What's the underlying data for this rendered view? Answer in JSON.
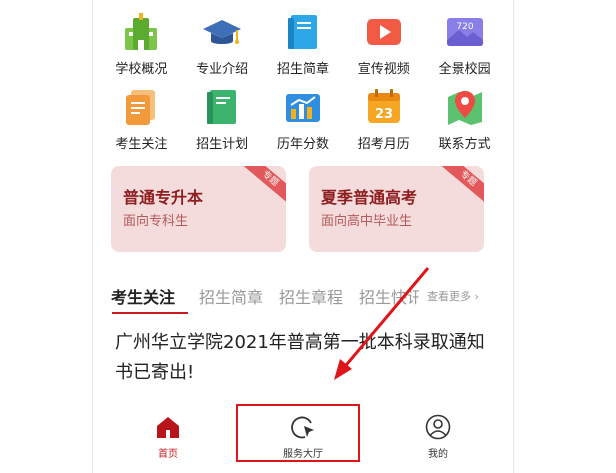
{
  "grid": {
    "row1": [
      {
        "label": "学校概况",
        "icon": "school-building-icon"
      },
      {
        "label": "专业介绍",
        "icon": "graduation-cap-icon"
      },
      {
        "label": "招生简章",
        "icon": "book-icon"
      },
      {
        "label": "宣传视频",
        "icon": "video-play-icon"
      },
      {
        "label": "全景校园",
        "icon": "panorama-720-icon"
      }
    ],
    "row2": [
      {
        "label": "考生关注",
        "icon": "document-stack-icon"
      },
      {
        "label": "招生计划",
        "icon": "green-book-icon"
      },
      {
        "label": "历年分数",
        "icon": "bar-chart-icon"
      },
      {
        "label": "招考月历",
        "icon": "calendar-icon"
      },
      {
        "label": "联系方式",
        "icon": "map-pin-icon"
      }
    ],
    "panorama_text": "720",
    "calendar_text": "23"
  },
  "cards": [
    {
      "title": "普通专升本",
      "subtitle": "面向专科生",
      "badge": "专题"
    },
    {
      "title": "夏季普通高考",
      "subtitle": "面向高中毕业生",
      "badge": "专题"
    }
  ],
  "tabs": {
    "items": [
      "考生关注",
      "招生简章",
      "招生章程",
      "招生快讯"
    ],
    "more": "查看更多 ›"
  },
  "news": {
    "headline": "广州华立学院2021年普高第一批本科录取通知书已寄出!"
  },
  "tabbar": {
    "home": "首页",
    "service": "服务大厅",
    "mine": "我的"
  },
  "colors": {
    "accent": "#c71b1f",
    "card_bg": "#f4dcdc",
    "annotation_red": "#e0141b"
  }
}
